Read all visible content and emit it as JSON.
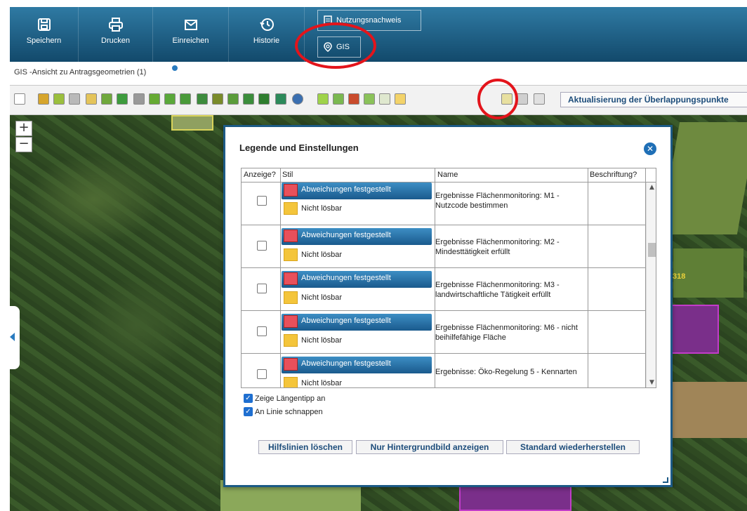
{
  "ribbon": {
    "buttons": [
      {
        "label": "Speichern",
        "icon": "save-icon"
      },
      {
        "label": "Drucken",
        "icon": "printer-icon"
      },
      {
        "label": "Einreichen",
        "icon": "send-mail-icon"
      },
      {
        "label": "Historie",
        "icon": "history-icon"
      }
    ],
    "nutzungsnachweis": "Nutzungsnachweis",
    "gis": "GIS"
  },
  "tab": {
    "label": "GIS -Ansicht zu Antragsgeometrien (1)"
  },
  "toolbar": {
    "update_button": "Aktualisierung der Überlappungspunkte"
  },
  "map": {
    "zoom_in": "+",
    "zoom_out": "−",
    "plot_number": "318"
  },
  "dialog": {
    "title": "Legende und Einstellungen",
    "close": "✕",
    "columns": [
      "Anzeige?",
      "Stil",
      "Name",
      "Beschriftung?"
    ],
    "rows": [
      {
        "style_a": "Abweichungen festgestellt",
        "style_b": "Nicht lösbar",
        "name": "Ergebnisse Flächenmonitoring: M1 - Nutzcode bestimmen"
      },
      {
        "style_a": "Abweichungen festgestellt",
        "style_b": "Nicht lösbar",
        "name": "Ergebnisse Flächenmonitoring: M2 - Mindesttätigkeit erfüllt"
      },
      {
        "style_a": "Abweichungen festgestellt",
        "style_b": "Nicht lösbar",
        "name": "Ergebnisse Flächenmonitoring: M3 - landwirtschaftliche Tätigkeit erfüllt"
      },
      {
        "style_a": "Abweichungen festgestellt",
        "style_b": "Nicht lösbar",
        "name": "Ergebnisse Flächenmonitoring: M6 - nicht beihilfefähige Fläche"
      },
      {
        "style_a": "Abweichungen festgestellt",
        "style_b": "Nicht lösbar",
        "name": "Ergebnisse: Öko-Regelung 5 - Kennarten"
      }
    ],
    "options": [
      {
        "label": "Zeige Längentipp an",
        "checked": true
      },
      {
        "label": "An Linie schnappen",
        "checked": true
      }
    ],
    "buttons": [
      "Hilfslinien löschen",
      "Nur Hintergrundbild anzeigen",
      "Standard wiederherstellen"
    ]
  },
  "colors": {
    "ribbon_top": "#2f7aa3",
    "ribbon_bottom": "#12496b",
    "highlight_ring": "#e3141b",
    "dialog_border": "#1c5a86"
  }
}
